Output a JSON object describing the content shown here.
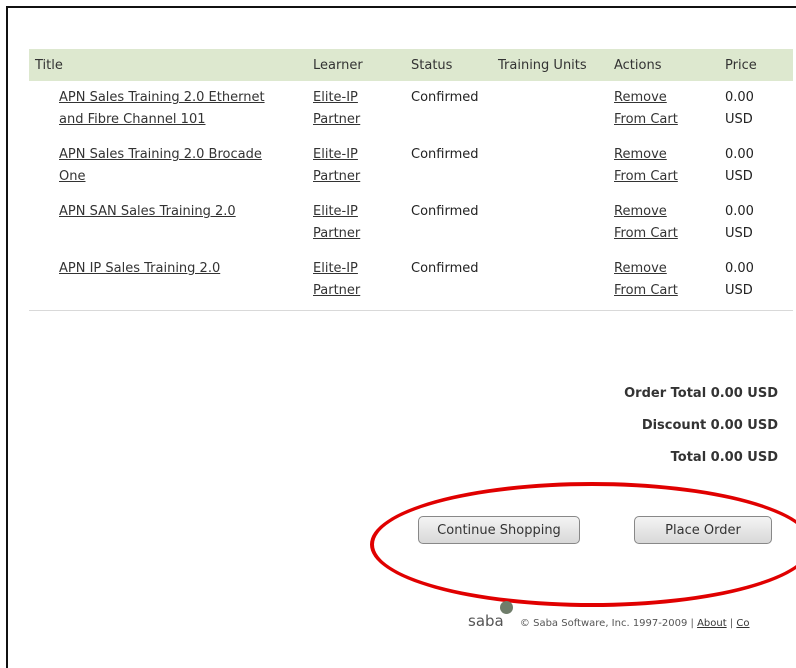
{
  "columns": {
    "title": "Title",
    "learner": "Learner",
    "status": "Status",
    "training_units": "Training Units",
    "actions": "Actions",
    "price": "Price"
  },
  "rows": [
    {
      "title_l1": "APN Sales Training 2.0 Ethernet",
      "title_l2": "and Fibre Channel 101",
      "learner_l1": "Elite-IP",
      "learner_l2": "Partner",
      "status": "Confirmed",
      "action_l1": "Remove",
      "action_l2": "From Cart",
      "price_l1": "0.00",
      "price_l2": "USD"
    },
    {
      "title_l1": "APN Sales Training 2.0 Brocade",
      "title_l2": "One",
      "learner_l1": "Elite-IP",
      "learner_l2": "Partner",
      "status": "Confirmed",
      "action_l1": "Remove",
      "action_l2": "From Cart",
      "price_l1": "0.00",
      "price_l2": "USD"
    },
    {
      "title_l1": "APN SAN Sales Training 2.0",
      "title_l2": "",
      "learner_l1": "Elite-IP",
      "learner_l2": "Partner",
      "status": "Confirmed",
      "action_l1": "Remove",
      "action_l2": "From Cart",
      "price_l1": "0.00",
      "price_l2": "USD"
    },
    {
      "title_l1": "APN IP Sales Training 2.0",
      "title_l2": "",
      "learner_l1": "Elite-IP",
      "learner_l2": "Partner",
      "status": "Confirmed",
      "action_l1": "Remove",
      "action_l2": "From Cart",
      "price_l1": "0.00",
      "price_l2": "USD"
    }
  ],
  "totals": {
    "order_total": "Order Total  0.00 USD",
    "discount": "Discount  0.00 USD",
    "total": "Total  0.00 USD"
  },
  "buttons": {
    "continue": "Continue Shopping",
    "place_order": "Place Order"
  },
  "footer": {
    "logo": "saba",
    "copyright": "© Saba Software, Inc. 1997-2009 |",
    "about": "About",
    "sep": "|",
    "cut_link": "Co"
  },
  "colors": {
    "header_bg": "#dde8cf",
    "highlight": "#e00000"
  }
}
